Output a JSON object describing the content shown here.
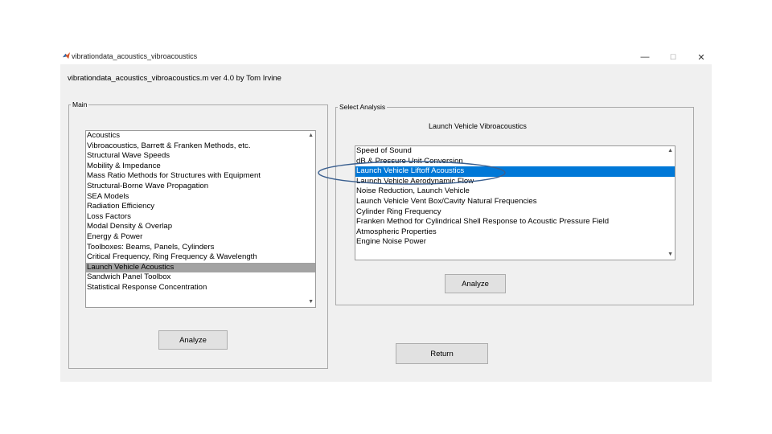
{
  "window": {
    "title": "vibrationdata_acoustics_vibroacoustics",
    "minimize_glyph": "—",
    "maximize_glyph": "☐",
    "close_glyph": "✕"
  },
  "header": {
    "text": "vibrationdata_acoustics_vibroacoustics.m  ver 4.0  by Tom Irvine"
  },
  "main_panel": {
    "title": "Main",
    "items": [
      "Acoustics",
      "Vibroacoustics, Barrett & Franken Methods, etc.",
      "Structural Wave Speeds",
      "Mobility & Impedance",
      "Mass Ratio Methods for Structures with Equipment",
      "Structural-Borne Wave Propagation",
      "SEA Models",
      "Radiation Efficiency",
      "Loss Factors",
      "Modal Density & Overlap",
      "Energy & Power",
      "Toolboxes:  Beams, Panels, Cylinders",
      "Critical Frequency, Ring Frequency & Wavelength",
      "Launch Vehicle Acoustics",
      "Sandwich Panel Toolbox",
      "Statistical Response Concentration"
    ],
    "selected": "Launch Vehicle Acoustics",
    "analyze_label": "Analyze"
  },
  "select_panel": {
    "title": "Select Analysis",
    "heading": "Launch Vehicle Vibroacoustics",
    "items": [
      "Speed of Sound",
      "dB & Pressure Unit Conversion",
      "Launch Vehicle Liftoff Acoustics",
      "Launch Vehicle Aerodynamic Flow",
      "Noise Reduction, Launch Vehicle",
      "Launch Vehicle Vent Box/Cavity Natural Frequencies",
      "Cylinder Ring Frequency",
      "Franken Method for Cylindrical Shell Response to Acoustic Pressure Field",
      "Atmospheric Properties",
      "Engine Noise Power"
    ],
    "selected": "Launch Vehicle Liftoff Acoustics",
    "analyze_label": "Analyze"
  },
  "return_label": "Return",
  "colors": {
    "selection_blue": "#0078d7",
    "selection_grey": "#a3a3a3",
    "annotation_ellipse": "#3a5f8f"
  }
}
